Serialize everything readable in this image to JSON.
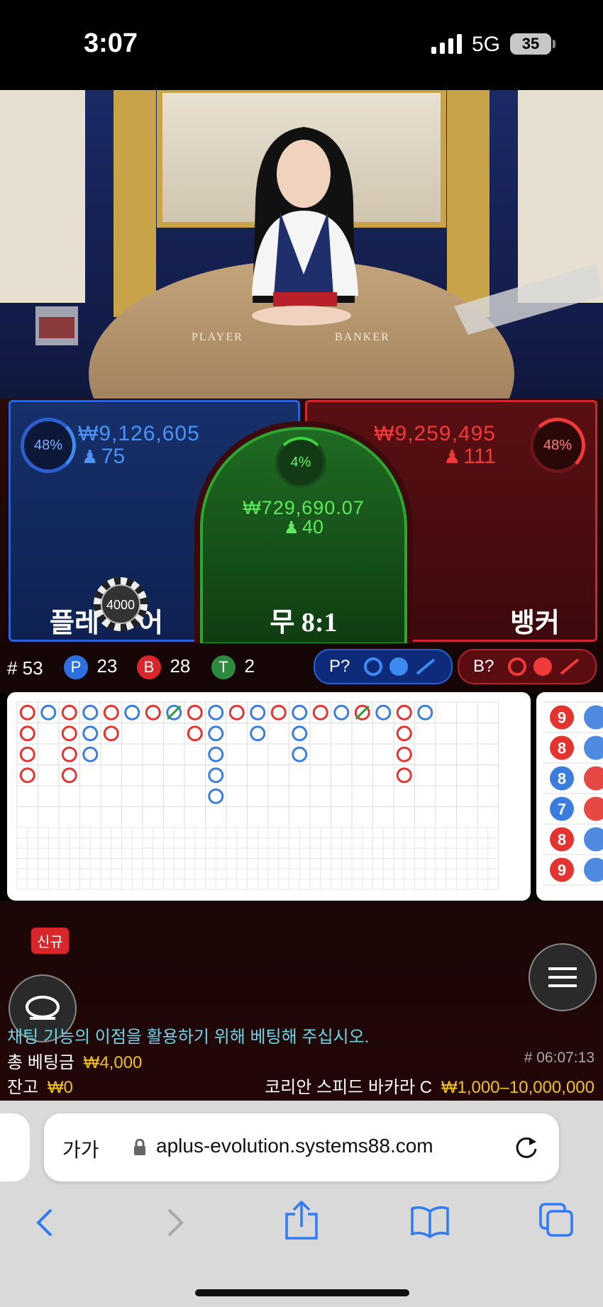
{
  "status_bar": {
    "time": "3:07",
    "network": "5G",
    "battery": "35"
  },
  "video": {
    "table_left": "PLAYER",
    "table_right": "BANKER"
  },
  "bets": {
    "player": {
      "percent": "48%",
      "amount": "₩9,126,605",
      "players": "75",
      "label_left": "플레",
      "label_right": "어",
      "chip": "4000",
      "color": "#3d8bf0"
    },
    "tie": {
      "percent": "4%",
      "amount": "₩729,690.07",
      "players": "40",
      "label": "무 8:1",
      "color": "#57e05a"
    },
    "banker": {
      "percent": "48%",
      "amount": "₩9,259,495",
      "players": "111",
      "label": "뱅커",
      "color": "#f03a3a"
    }
  },
  "stats": {
    "rounds": "# 53",
    "player_wins": "23",
    "banker_wins": "28",
    "ties": "2",
    "player_letter": "P",
    "banker_letter": "B",
    "tie_letter": "T",
    "player_predict": "P?",
    "banker_predict": "B?"
  },
  "roadmap": {
    "big_road": [
      [
        "B",
        "P",
        "B",
        "P",
        "B",
        "P",
        "B",
        "PT",
        "B",
        "P",
        "B",
        "P",
        "B",
        "P",
        "B",
        "P",
        "BT",
        "P",
        "B",
        "P"
      ],
      [
        "B",
        "",
        "B",
        "P",
        "B",
        "",
        "",
        "",
        "B",
        "P",
        "",
        "P",
        "",
        "P",
        "",
        "",
        "",
        "",
        "B",
        ""
      ],
      [
        "B",
        "",
        "B",
        "P",
        "",
        "",
        "",
        "",
        "",
        "P",
        "",
        "",
        "",
        "P",
        "",
        "",
        "",
        "",
        "B",
        ""
      ],
      [
        "B",
        "",
        "B",
        "",
        "",
        "",
        "",
        "",
        "",
        "P",
        "",
        "",
        "",
        "",
        "",
        "",
        "",
        "",
        "B",
        ""
      ],
      [
        "",
        "",
        "",
        "",
        "",
        "",
        "",
        "",
        "",
        "P",
        "",
        "",
        "",
        "",
        "",
        "",
        "",
        "",
        "",
        ""
      ]
    ],
    "bead_side": [
      {
        "result": "B",
        "value": "9"
      },
      {
        "result": "B",
        "value": "8"
      },
      {
        "result": "P",
        "value": "8"
      },
      {
        "result": "P",
        "value": "7"
      },
      {
        "result": "B",
        "value": "8"
      },
      {
        "result": "B",
        "value": "9"
      }
    ]
  },
  "bottom": {
    "new_badge": "신규",
    "chat_notice": "채팅 기능의 이점을 활용하기 위해 베팅해 주십시오.",
    "total_bet_label": "총 베팅금",
    "total_bet_value": "₩4,000",
    "round_id": "# 06:07:13",
    "balance_label": "잔고",
    "balance_value": "₩0",
    "table_name": "코리안 스피드 바카라 C",
    "limits": "₩1,000–10,000,000"
  },
  "browser": {
    "text_size": "가가",
    "url": "aplus-evolution.systems88.com"
  }
}
